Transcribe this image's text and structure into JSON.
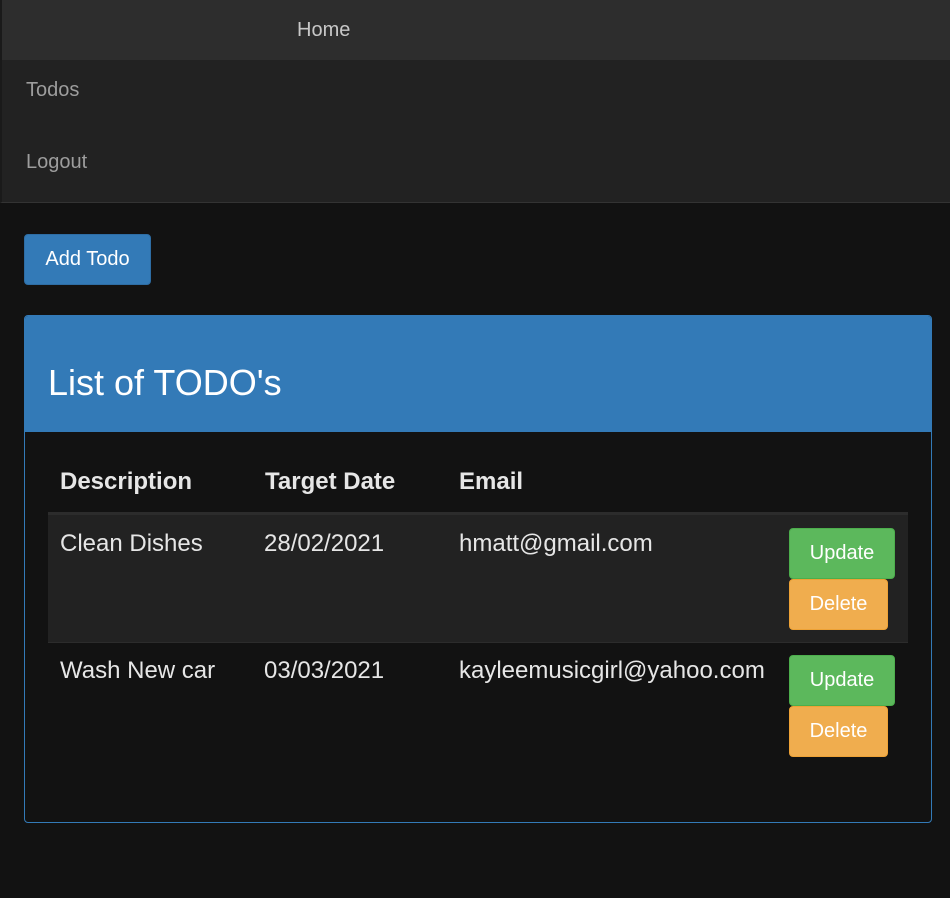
{
  "nav": {
    "home": "Home",
    "todos": "Todos",
    "logout": "Logout"
  },
  "toolbar": {
    "add_label": "Add Todo"
  },
  "panel": {
    "title": "List of TODO's",
    "columns": [
      "Description",
      "Target Date",
      "Email"
    ],
    "rows": [
      {
        "description": "Clean Dishes",
        "target_date": "28/02/2021",
        "email": "hmatt@gmail.com",
        "update_label": "Update",
        "delete_label": "Delete"
      },
      {
        "description": "Wash New car",
        "target_date": "03/03/2021",
        "email": "kayleemusicgirl@yahoo.com",
        "update_label": "Update",
        "delete_label": "Delete"
      }
    ]
  },
  "colors": {
    "primary": "#337ab7",
    "success": "#5cb85c",
    "warning": "#f0ad4e",
    "background": "#121212",
    "navbar": "#222222"
  }
}
